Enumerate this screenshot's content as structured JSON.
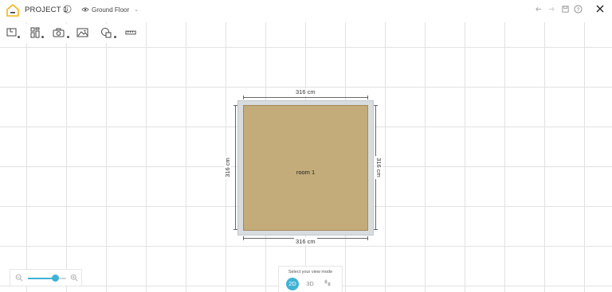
{
  "header": {
    "project_title": "PROJECT 1",
    "floor_label": "Ground Floor"
  },
  "icons": {
    "logo": "home-logo-icon",
    "info": "info-icon",
    "floor": "floor-eye-icon",
    "undo": "undo-icon",
    "redo": "redo-icon",
    "save": "save-icon",
    "help": "help-icon",
    "close": "close-icon"
  },
  "toolbar": {
    "tools": [
      "draw-room-icon",
      "furniture-catalog-icon",
      "camera-icon",
      "picture-icon",
      "shapes-icon",
      "measure-icon"
    ]
  },
  "room": {
    "name": "room 1",
    "dim_top": "316 cm",
    "dim_bottom": "316 cm",
    "dim_left": "316 cm",
    "dim_right": "316 cm",
    "floor_color": "#c3ab7a",
    "wall_color": "#d8dcdf"
  },
  "zoom": {
    "level_fraction": 0.7
  },
  "viewmode": {
    "title": "Select your view mode",
    "mode_2d": "2D",
    "mode_3d": "3D",
    "active": "2D",
    "accent": "#42b1d6"
  },
  "colors": {
    "brand": "#f2b51c",
    "accent": "#42b1d6"
  }
}
